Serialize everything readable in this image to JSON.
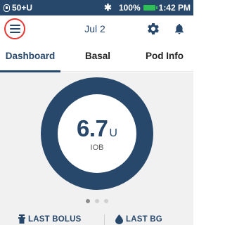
{
  "status_bar": {
    "pod_status": "50+U",
    "bluetooth_icon": "bluetooth-icon",
    "battery_percent": "100%",
    "battery_level": 1.0,
    "time": "1:42 PM"
  },
  "header": {
    "date": "Jul 2",
    "menu_icon": "hamburger-menu-icon",
    "settings_icon": "gear-icon",
    "notifications_icon": "bell-icon"
  },
  "tabs": [
    {
      "label": "Dashboard",
      "active": true
    },
    {
      "label": "Basal",
      "active": false
    },
    {
      "label": "Pod Info",
      "active": false
    }
  ],
  "dashboard": {
    "iob_value": "6.7",
    "iob_unit": "U",
    "iob_label": "IOB",
    "page_indicator": {
      "count": 3,
      "active_index": 0
    },
    "last_bolus_label": "LAST BOLUS",
    "last_bg_label": "LAST BG"
  },
  "colors": {
    "primary": "#27476b",
    "highlight_ring": "#e53935",
    "battery": "#2fbf57",
    "panel_bg": "#f1f1f1"
  }
}
